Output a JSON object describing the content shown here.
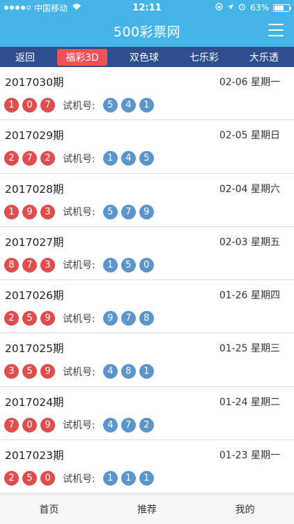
{
  "status_bar": {
    "carrier": "中国移动",
    "time": "12:11",
    "battery": "63%",
    "battery_level": 0.63,
    "signal_bars": 4
  },
  "header": {
    "title": "500彩票网",
    "menu_icon": "hamburger-menu-icon"
  },
  "tabs": [
    {
      "label": "返回",
      "active": false
    },
    {
      "label": "福彩3D",
      "active": true
    },
    {
      "label": "双色球",
      "active": false
    },
    {
      "label": "七乐彩",
      "active": false
    },
    {
      "label": "大乐透",
      "active": false
    }
  ],
  "trial_label": "试机号:",
  "draws": [
    {
      "issue": "2017030期",
      "date": "02-06 星期一",
      "numbers": [
        "1",
        "0",
        "7"
      ],
      "trial": [
        "5",
        "4",
        "1"
      ]
    },
    {
      "issue": "2017029期",
      "date": "02-05 星期日",
      "numbers": [
        "2",
        "7",
        "2"
      ],
      "trial": [
        "1",
        "4",
        "5"
      ]
    },
    {
      "issue": "2017028期",
      "date": "02-04 星期六",
      "numbers": [
        "1",
        "9",
        "3"
      ],
      "trial": [
        "5",
        "7",
        "9"
      ]
    },
    {
      "issue": "2017027期",
      "date": "02-03 星期五",
      "numbers": [
        "8",
        "7",
        "3"
      ],
      "trial": [
        "1",
        "5",
        "0"
      ]
    },
    {
      "issue": "2017026期",
      "date": "01-26 星期四",
      "numbers": [
        "2",
        "5",
        "9"
      ],
      "trial": [
        "9",
        "7",
        "8"
      ]
    },
    {
      "issue": "2017025期",
      "date": "01-25 星期三",
      "numbers": [
        "3",
        "5",
        "9"
      ],
      "trial": [
        "4",
        "8",
        "1"
      ]
    },
    {
      "issue": "2017024期",
      "date": "01-24 星期二",
      "numbers": [
        "7",
        "0",
        "9"
      ],
      "trial": [
        "4",
        "7",
        "2"
      ]
    },
    {
      "issue": "2017023期",
      "date": "01-23 星期一",
      "numbers": [
        "2",
        "5",
        "0"
      ],
      "trial": [
        "1",
        "1",
        "1"
      ]
    }
  ],
  "bottom_nav": [
    {
      "label": "首页"
    },
    {
      "label": "推荐"
    },
    {
      "label": "我的"
    }
  ],
  "colors": {
    "header_bg": "#45b5e8",
    "tabs_bg": "#2e4f8f",
    "active_tab": "#f0525a",
    "red_ball": "#df4d4d",
    "blue_ball": "#5b95cc"
  }
}
